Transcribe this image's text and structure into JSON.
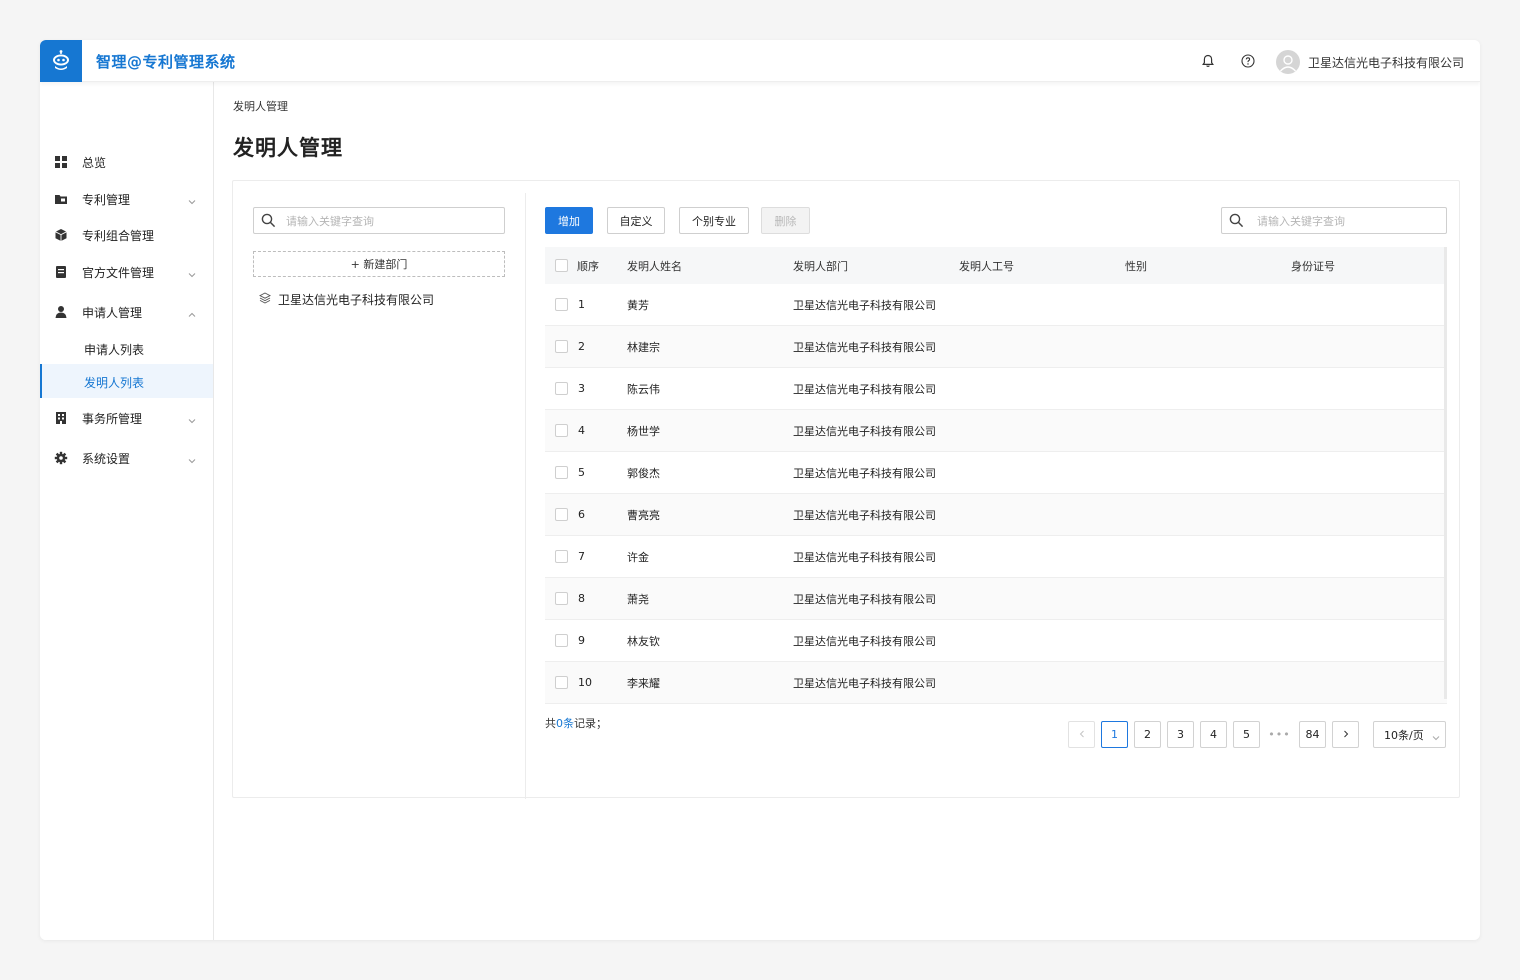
{
  "header": {
    "app_title": "智理@专利管理系统",
    "user_name": "卫星达信光电子科技有限公司",
    "brand_color": "#1677d2"
  },
  "sidebar": {
    "items": [
      {
        "label": "总览",
        "icon": "grid-icon"
      },
      {
        "label": "专利管理",
        "icon": "folder-icon"
      },
      {
        "label": "专利组合管理",
        "icon": "cube-icon"
      },
      {
        "label": "官方文件管理",
        "icon": "document-icon"
      },
      {
        "label": "申请人管理",
        "icon": "user-icon"
      },
      {
        "label": "事务所管理",
        "icon": "building-icon"
      },
      {
        "label": "系统设置",
        "icon": "gear-icon"
      }
    ],
    "sub_items": [
      {
        "label": "申请人列表"
      },
      {
        "label": "发明人列表",
        "active": true
      }
    ]
  },
  "breadcrumb": "发明人管理",
  "page_title": "发明人管理",
  "left_panel": {
    "search_placeholder": "请输入关键字查询",
    "new_dept_label": "+ 新建部门",
    "tree_root": "卫星达信光电子科技有限公司"
  },
  "toolbar": {
    "add_label": "增加",
    "custom_label": "自定义",
    "individual_label": "个别专业",
    "delete_label": "删除",
    "search_placeholder": "请输入关键字查询"
  },
  "table": {
    "columns": [
      "顺序",
      "发明人姓名",
      "发明人部门",
      "发明人工号",
      "性别",
      "身份证号"
    ],
    "rows": [
      {
        "order": "1",
        "name": "黄芳",
        "dept": "卫星达信光电子科技有限公司"
      },
      {
        "order": "2",
        "name": "林建宗",
        "dept": "卫星达信光电子科技有限公司"
      },
      {
        "order": "3",
        "name": "陈云伟",
        "dept": "卫星达信光电子科技有限公司"
      },
      {
        "order": "4",
        "name": "杨世学",
        "dept": "卫星达信光电子科技有限公司"
      },
      {
        "order": "5",
        "name": "郭俊杰",
        "dept": "卫星达信光电子科技有限公司"
      },
      {
        "order": "6",
        "name": "曹亮亮",
        "dept": "卫星达信光电子科技有限公司"
      },
      {
        "order": "7",
        "name": "许金",
        "dept": "卫星达信光电子科技有限公司"
      },
      {
        "order": "8",
        "name": "萧尧",
        "dept": "卫星达信光电子科技有限公司"
      },
      {
        "order": "9",
        "name": "林友钦",
        "dept": "卫星达信光电子科技有限公司"
      },
      {
        "order": "10",
        "name": "李来耀",
        "dept": "卫星达信光电子科技有限公司"
      }
    ]
  },
  "footer": {
    "total_prefix": "共",
    "total_count": "0条",
    "total_suffix": "记录；",
    "pages": [
      "1",
      "2",
      "3",
      "4",
      "5"
    ],
    "last_page": "84",
    "ellipsis": "•••",
    "page_size": "10条/页",
    "current_page": "1"
  }
}
